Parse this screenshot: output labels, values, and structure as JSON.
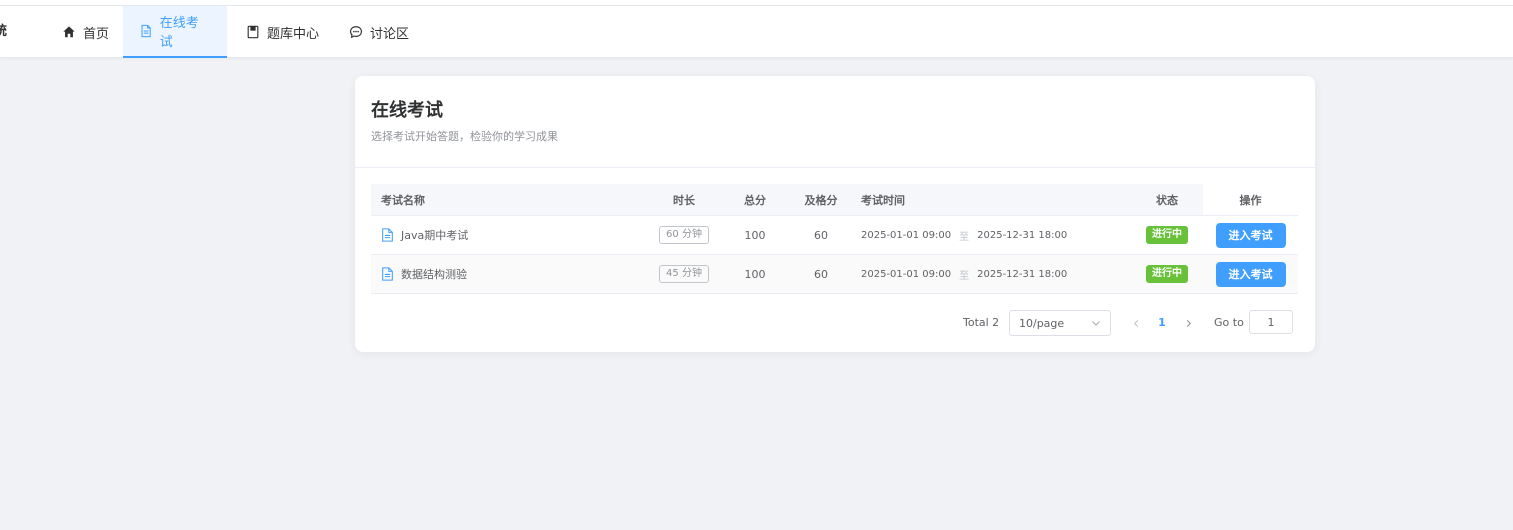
{
  "brand": {
    "text": "统"
  },
  "nav": {
    "items": [
      {
        "label": "首页"
      },
      {
        "label": "在线考试"
      },
      {
        "label": "题库中心"
      },
      {
        "label": "讨论区"
      }
    ],
    "active_index": 1
  },
  "card": {
    "title": "在线考试",
    "subtitle": "选择考试开始答题，检验你的学习成果"
  },
  "table": {
    "headers": {
      "name": "考试名称",
      "duration": "时长",
      "total": "总分",
      "pass": "及格分",
      "time": "考试时间",
      "status": "状态",
      "action": "操作"
    },
    "rows": [
      {
        "name": "Java期中考试",
        "duration": "60 分钟",
        "total": "100",
        "pass": "60",
        "start": "2025-01-01 09:00",
        "sep": "至",
        "end": "2025-12-31 18:00",
        "status": "进行中",
        "action": "进入考试"
      },
      {
        "name": "数据结构测验",
        "duration": "45 分钟",
        "total": "100",
        "pass": "60",
        "start": "2025-01-01 09:00",
        "sep": "至",
        "end": "2025-12-31 18:00",
        "status": "进行中",
        "action": "进入考试"
      }
    ]
  },
  "pagination": {
    "total": "Total 2",
    "page_size": "10/page",
    "current": "1",
    "goto_label": "Go to",
    "goto_value": "1"
  },
  "colors": {
    "primary": "#409eff",
    "success": "#67c23a",
    "background": "#f0f2f5"
  }
}
